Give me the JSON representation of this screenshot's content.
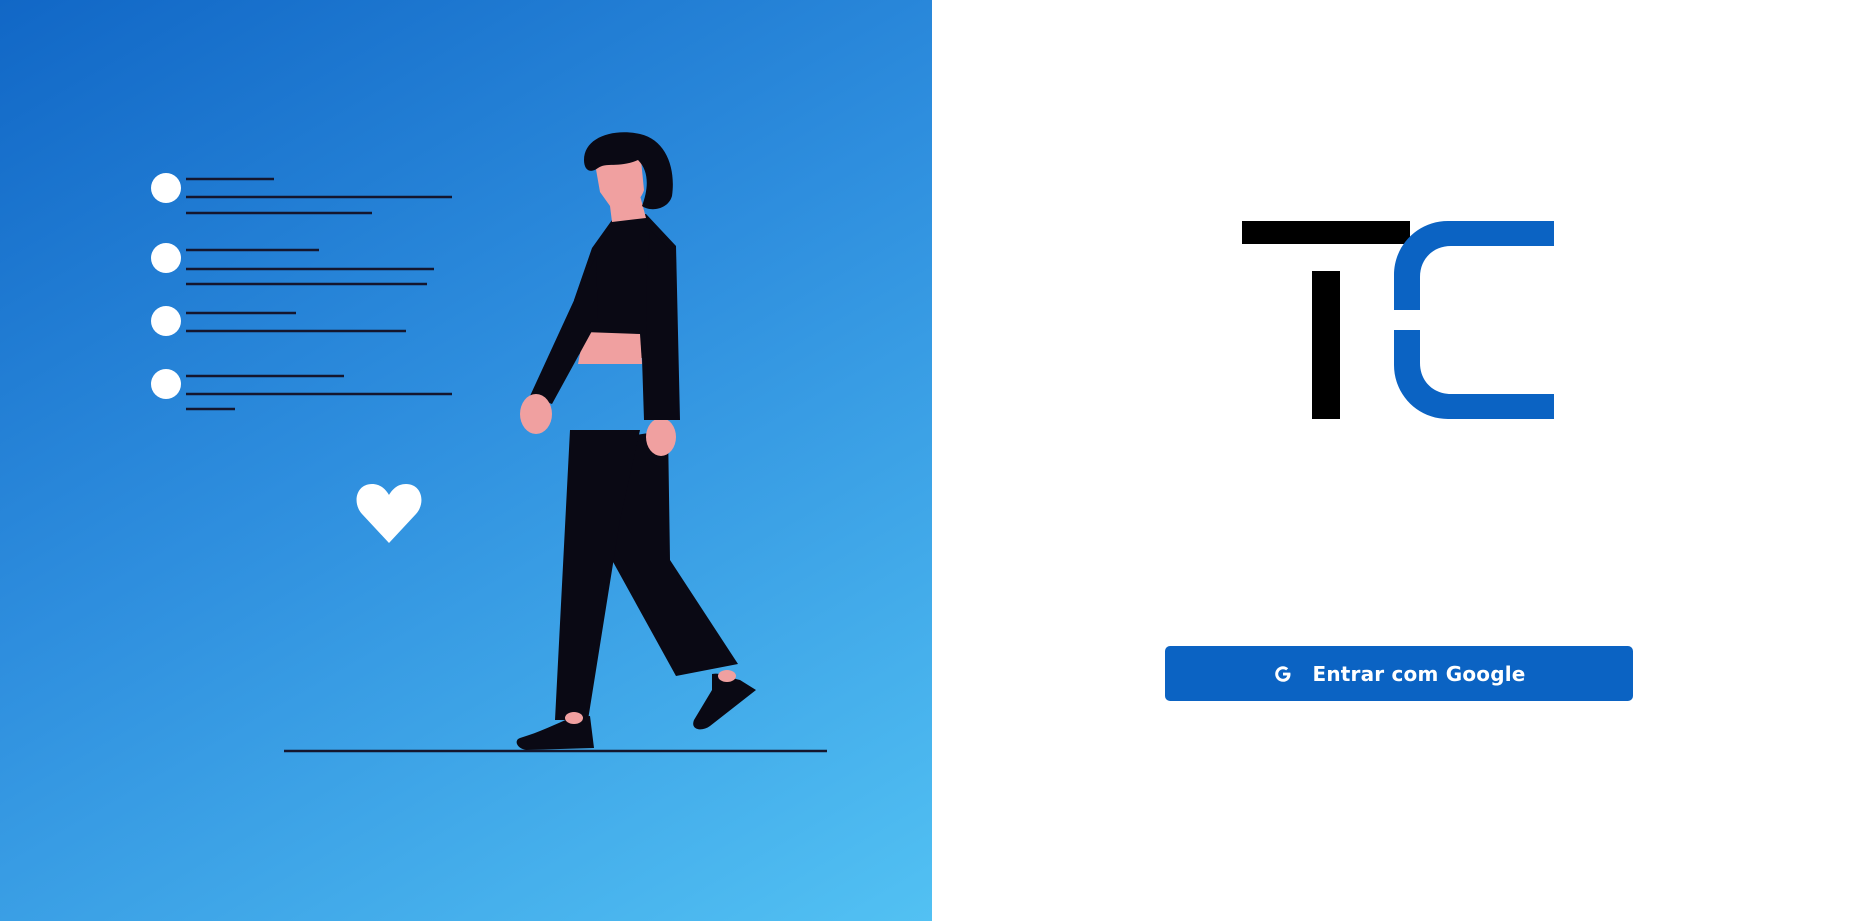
{
  "colors": {
    "gradient_start": "#1167c6",
    "gradient_end": "#52c1f3",
    "brand_blue": "#0b63c3",
    "logo_black": "#000000",
    "figure_dark": "#0a0914",
    "skin": "#f0a0a0"
  },
  "hero": {
    "illustration": "woman-walking-with-checklist",
    "icons": [
      "checklist-bullet-icon",
      "heart-icon"
    ]
  },
  "logo": {
    "text": "TC",
    "icon": "tc-logo-mark"
  },
  "login": {
    "button_label": "Entrar com Google",
    "button_icon": "google-g-icon"
  }
}
